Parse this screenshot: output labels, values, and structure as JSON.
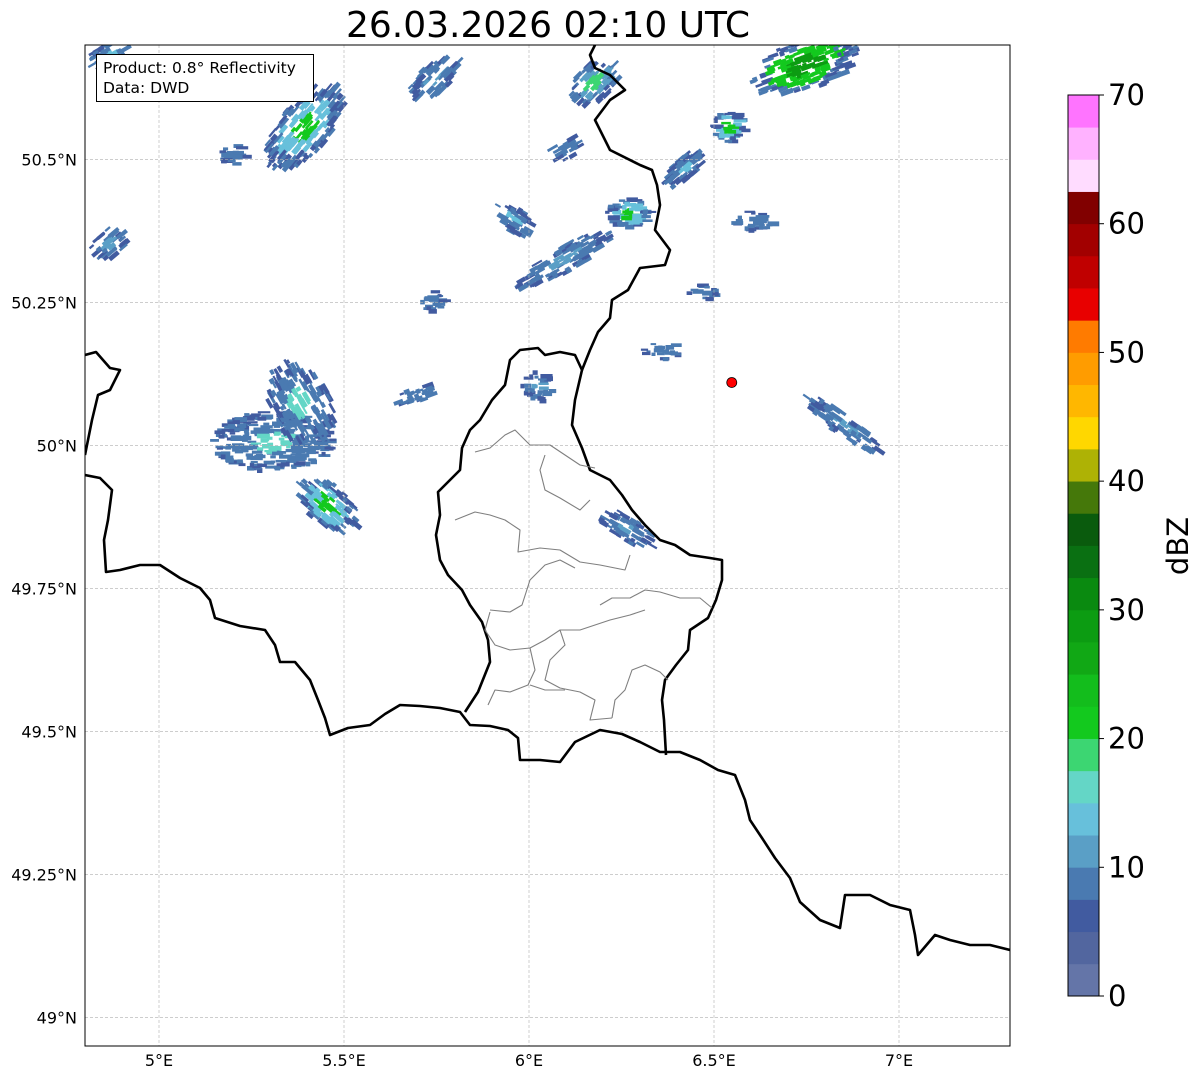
{
  "title": "26.03.2026 02:10 UTC",
  "info": {
    "line1": "Product: 0.8° Reflectivity",
    "line2": "Data: DWD"
  },
  "map": {
    "lon_range": [
      4.8,
      7.3
    ],
    "lat_range": [
      48.95,
      50.7
    ],
    "lon_ticks": [
      {
        "value": 5.0,
        "label": "5°E"
      },
      {
        "value": 5.5,
        "label": "5.5°E"
      },
      {
        "value": 6.0,
        "label": "6°E"
      },
      {
        "value": 6.5,
        "label": "6.5°E"
      },
      {
        "value": 7.0,
        "label": "7°E"
      }
    ],
    "lat_ticks": [
      {
        "value": 50.5,
        "label": "50.5°N"
      },
      {
        "value": 50.25,
        "label": "50.25°N"
      },
      {
        "value": 50.0,
        "label": "50°N"
      },
      {
        "value": 49.75,
        "label": "49.75°N"
      },
      {
        "value": 49.5,
        "label": "49.5°N"
      },
      {
        "value": 49.25,
        "label": "49.25°N"
      },
      {
        "value": 49.0,
        "label": "49°N"
      }
    ],
    "grid": true,
    "radar_site": {
      "lon": 6.548,
      "lat": 50.11,
      "color": "#ff0000"
    }
  },
  "colorbar": {
    "label": "dBZ",
    "min": 0,
    "max": 70,
    "step": 2.5,
    "ticks": [
      {
        "value": 0,
        "label": "0"
      },
      {
        "value": 10,
        "label": "10"
      },
      {
        "value": 20,
        "label": "20"
      },
      {
        "value": 30,
        "label": "30"
      },
      {
        "value": 40,
        "label": "40"
      },
      {
        "value": 50,
        "label": "50"
      },
      {
        "value": 60,
        "label": "60"
      },
      {
        "value": 70,
        "label": "70"
      }
    ],
    "colors": [
      "#6475a8",
      "#52669f",
      "#415ba0",
      "#4a7ab1",
      "#5a9fc6",
      "#67c0db",
      "#64d6c6",
      "#3cd672",
      "#13c91e",
      "#13bd1c",
      "#11a815",
      "#0c9c12",
      "#0a8a10",
      "#0a7012",
      "#0a5b0d",
      "#45780a",
      "#aeb205",
      "#ffd700",
      "#ffb700",
      "#ff9c00",
      "#ff7b00",
      "#e80000",
      "#c00000",
      "#a20000",
      "#810000",
      "#ffdcff",
      "#ffb2ff",
      "#ff74ff"
    ]
  },
  "legend_colors": {
    "country_border": "#000000",
    "district_border": "#7f7f7f",
    "grid": "#b0b0b0"
  }
}
